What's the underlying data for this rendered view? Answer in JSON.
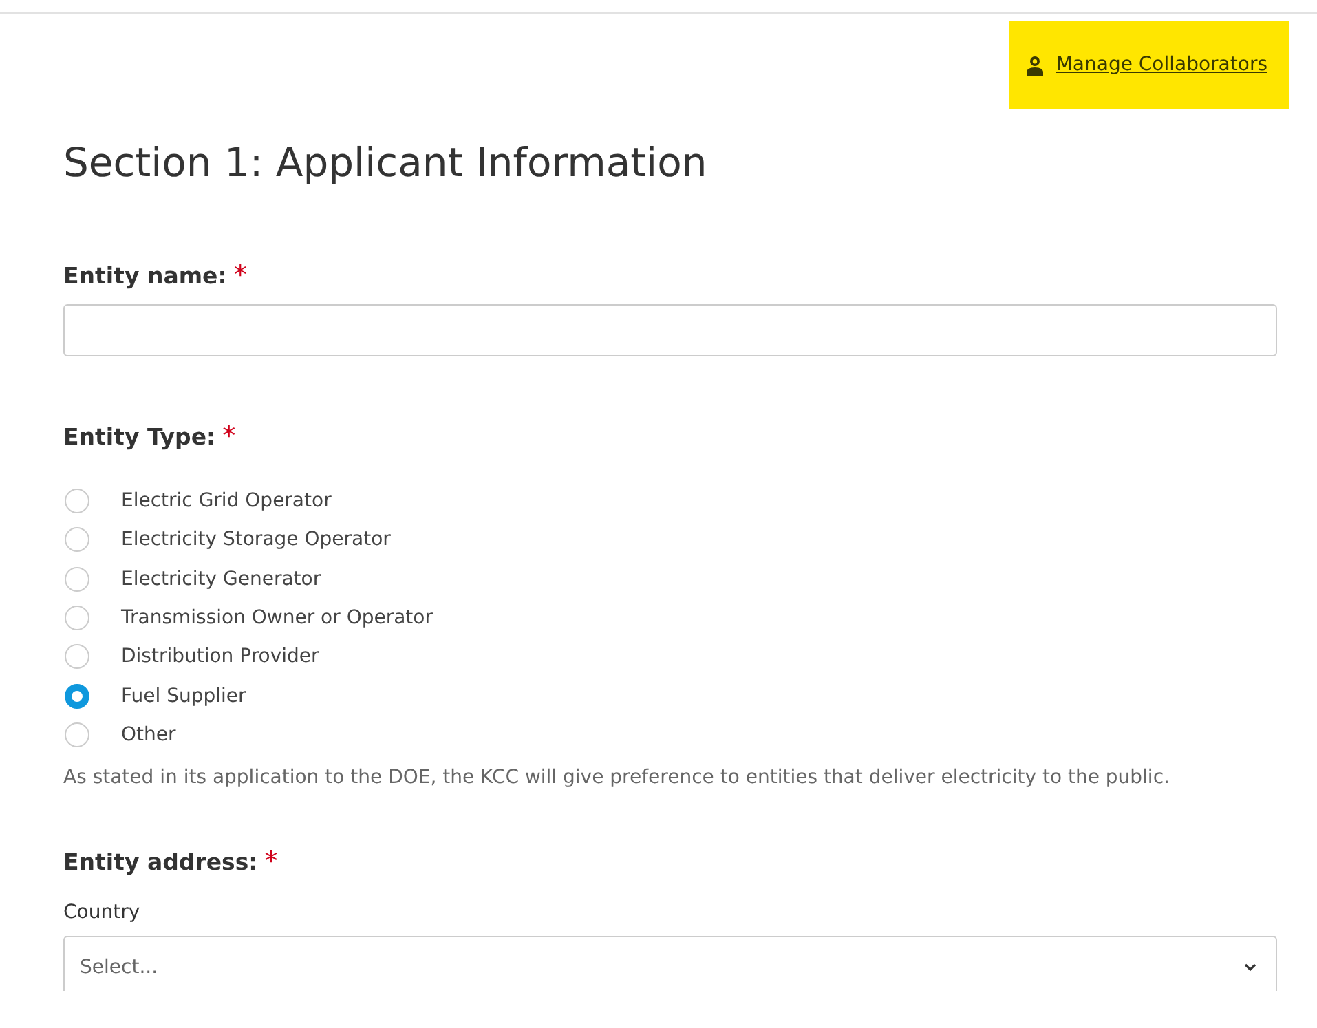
{
  "header": {
    "collaborators_link": "Manage Collaborators"
  },
  "section_title": "Section 1: Applicant Information",
  "entity_name": {
    "label": "Entity name:",
    "required_mark": "*"
  },
  "entity_type": {
    "label": "Entity Type:",
    "required_mark": "*",
    "options": [
      {
        "label": "Electric Grid Operator",
        "selected": false
      },
      {
        "label": "Electricity Storage Operator",
        "selected": false
      },
      {
        "label": "Electricity Generator",
        "selected": false
      },
      {
        "label": "Transmission Owner or Operator",
        "selected": false
      },
      {
        "label": "Distribution Provider",
        "selected": false
      },
      {
        "label": "Fuel Supplier",
        "selected": true
      },
      {
        "label": "Other",
        "selected": false
      }
    ],
    "help": "As stated in its application to the DOE, the KCC will give preference to entities that deliver electricity to the public."
  },
  "entity_address": {
    "label": "Entity address:",
    "required_mark": "*",
    "country_label": "Country",
    "country_select": {
      "placeholder": "Select..."
    }
  }
}
